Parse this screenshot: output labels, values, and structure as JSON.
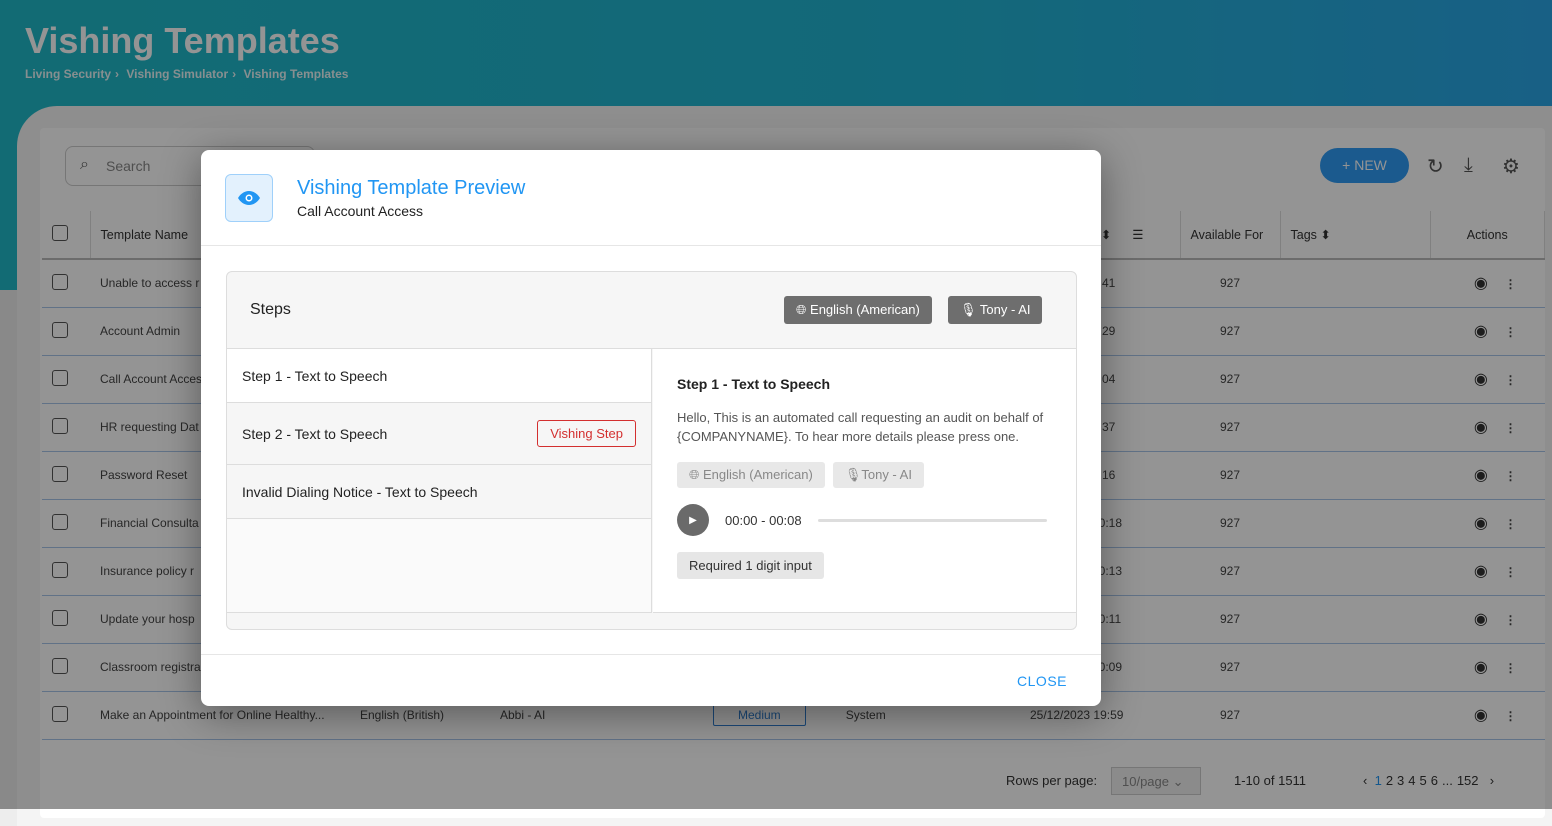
{
  "page": {
    "title": "Vishing Templates",
    "breadcrumb": [
      "Living Security",
      "Vishing Simulator",
      "Vishing Templates"
    ]
  },
  "toolbar": {
    "search_placeholder": "Search",
    "new_label": "NEW"
  },
  "table": {
    "headers": {
      "template_name": "Template Name",
      "date_fragment": "d",
      "available_for": "Available For",
      "tags": "Tags",
      "actions": "Actions"
    },
    "rows": [
      {
        "name": "Unable to access r",
        "date": "7:41",
        "available": "927"
      },
      {
        "name": "Account Admin",
        "date": "7:29",
        "available": "927"
      },
      {
        "name": "Call Account Acces",
        "date": "7:04",
        "available": "927"
      },
      {
        "name": "HR requesting Dat",
        "date": "6:37",
        "available": "927"
      },
      {
        "name": "Password Reset",
        "date": "6:16",
        "available": "927"
      },
      {
        "name": "Financial Consulta",
        "date": "20:18",
        "available": "927"
      },
      {
        "name": "Insurance policy r",
        "date": "20:13",
        "available": "927"
      },
      {
        "name": "Update your hosp",
        "date": "20:11",
        "available": "927"
      },
      {
        "name": "Classroom registra",
        "date": "20:09",
        "available": "927"
      }
    ],
    "last_row": {
      "name": "Make an Appointment for Online Healthy...",
      "language": "English (British)",
      "voice": "Abbi - AI",
      "difficulty": "Medium",
      "created_by": "System",
      "date": "25/12/2023 19:59",
      "available": "927"
    }
  },
  "pagination": {
    "rows_per_page_label": "Rows per page:",
    "rows_per_page": "10/page",
    "range": "1-10 of 1511",
    "pages": [
      "1",
      "2",
      "3",
      "4",
      "5",
      "6",
      "...",
      "152"
    ],
    "current": "1"
  },
  "modal": {
    "title": "Vishing Template Preview",
    "subtitle": "Call Account Access",
    "steps_label": "Steps",
    "language": "English (American)",
    "voice": "Tony - AI",
    "steps": [
      {
        "label": "Step 1 - Text to Speech"
      },
      {
        "label": "Step 2 - Text to Speech",
        "badge": "Vishing Step"
      },
      {
        "label": "Invalid Dialing Notice - Text to Speech"
      }
    ],
    "detail": {
      "title": "Step 1 - Text to Speech",
      "text": "Hello, This is an automated call requesting an audit on behalf of {COMPANYNAME}. To hear more details please press one.",
      "language": "English (American)",
      "voice": "Tony - AI",
      "time": "00:00 - 00:08",
      "progress": 0,
      "requirement": "Required 1 digit input"
    },
    "close_label": "CLOSE"
  },
  "colors": {
    "accent": "#2196f3",
    "danger": "#d32f2f",
    "header": "#22b4d2"
  }
}
